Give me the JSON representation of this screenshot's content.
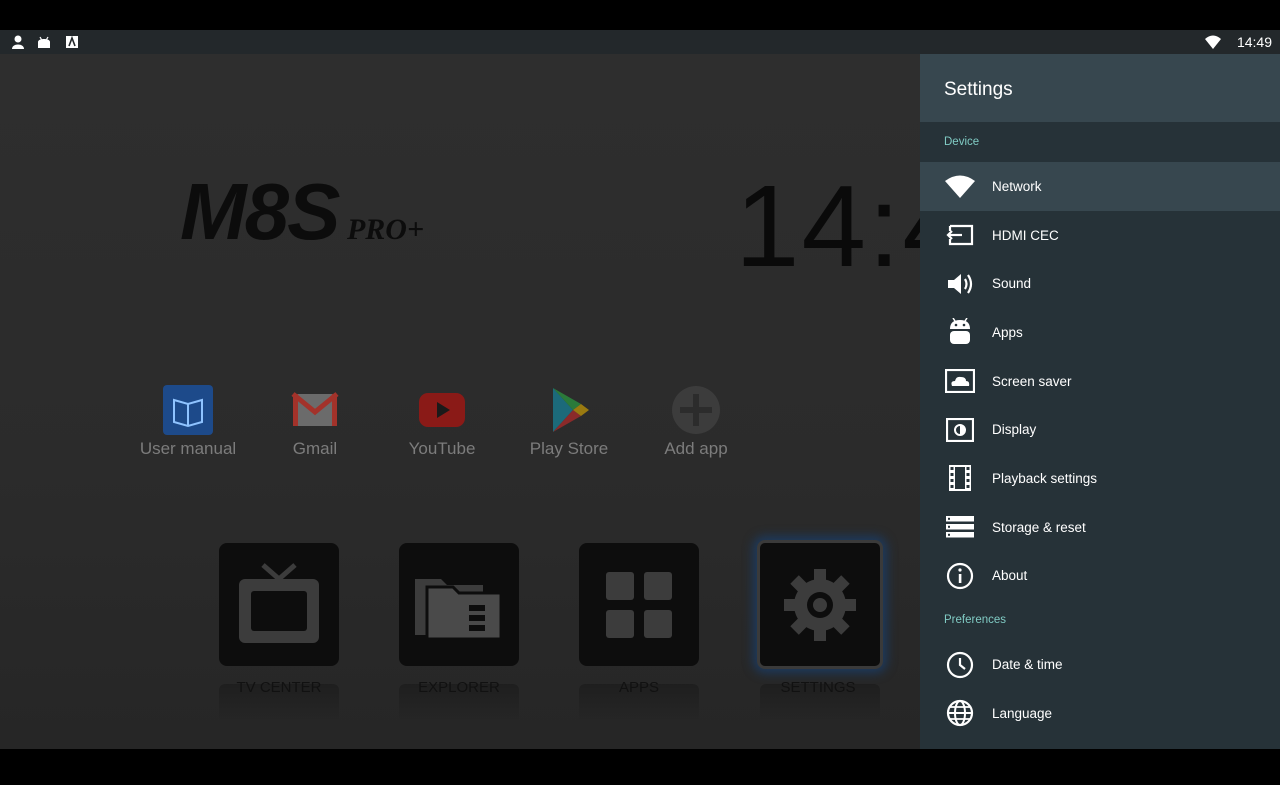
{
  "status_bar": {
    "time": "14:49"
  },
  "home": {
    "logo_main": "M8S",
    "logo_sub": "PRO+",
    "clock": "14:4",
    "apps": [
      {
        "label": "User manual",
        "icon": "book-icon"
      },
      {
        "label": "Gmail",
        "icon": "gmail-icon"
      },
      {
        "label": "YouTube",
        "icon": "youtube-icon"
      },
      {
        "label": "Play Store",
        "icon": "play-store-icon"
      },
      {
        "label": "Add app",
        "icon": "add-icon"
      }
    ],
    "tiles": [
      {
        "label": "TV CENTER",
        "icon": "tv-icon"
      },
      {
        "label": "EXPLORER",
        "icon": "folder-icon"
      },
      {
        "label": "APPS",
        "icon": "grid-icon"
      },
      {
        "label": "SETTINGS",
        "icon": "gear-icon"
      }
    ]
  },
  "settings": {
    "title": "Settings",
    "device_label": "Device",
    "preferences_label": "Preferences",
    "device_items": [
      {
        "label": "Network",
        "icon": "wifi-icon"
      },
      {
        "label": "HDMI CEC",
        "icon": "hdmi-input-icon"
      },
      {
        "label": "Sound",
        "icon": "speaker-icon"
      },
      {
        "label": "Apps",
        "icon": "android-icon"
      },
      {
        "label": "Screen saver",
        "icon": "screensaver-icon"
      },
      {
        "label": "Display",
        "icon": "display-icon"
      },
      {
        "label": "Playback settings",
        "icon": "film-icon"
      },
      {
        "label": "Storage & reset",
        "icon": "storage-icon"
      },
      {
        "label": "About",
        "icon": "info-icon"
      }
    ],
    "preference_items": [
      {
        "label": "Date & time",
        "icon": "clock-icon"
      },
      {
        "label": "Language",
        "icon": "globe-icon"
      }
    ],
    "selected": "Network"
  },
  "colors": {
    "panel_bg": "#263238",
    "panel_header": "#37474f",
    "section_label": "#80cbc4",
    "focus_glow": "#1d3a5e"
  }
}
